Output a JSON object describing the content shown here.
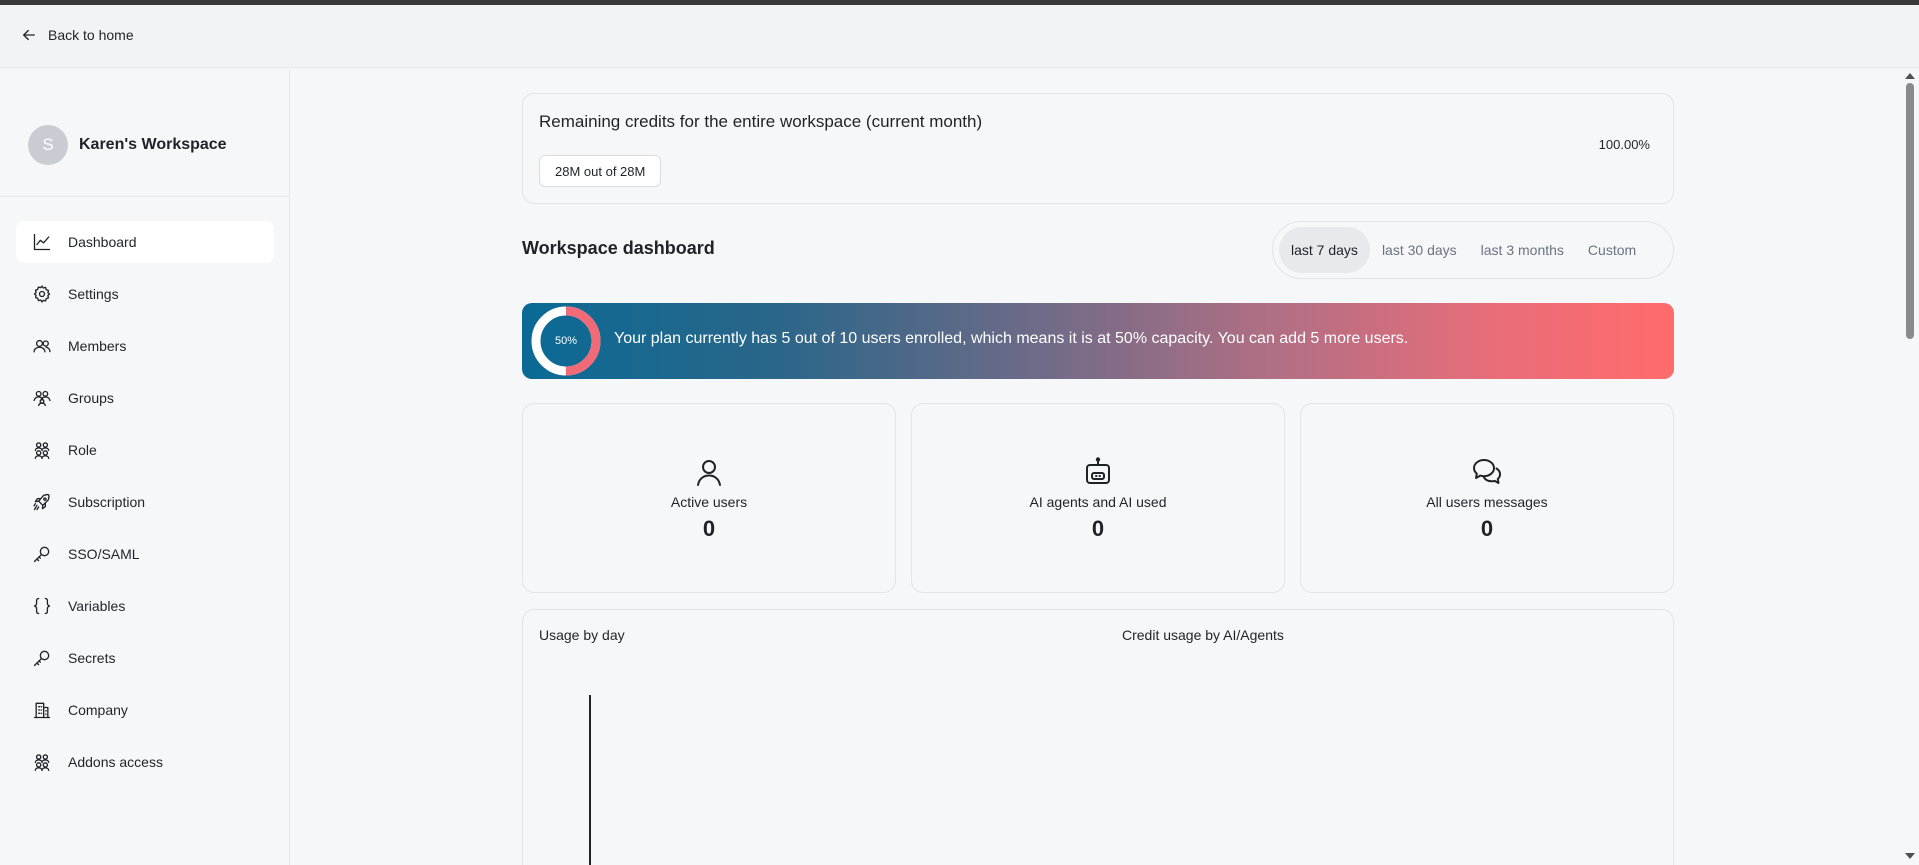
{
  "topbar": {
    "back_label": "Back to home"
  },
  "workspace": {
    "avatar_letter": "S",
    "name": "Karen's Workspace"
  },
  "sidebar": {
    "items": [
      {
        "label": "Dashboard",
        "icon": "chart-line-icon",
        "active": true
      },
      {
        "label": "Settings",
        "icon": "gear-icon"
      },
      {
        "label": "Members",
        "icon": "users-icon"
      },
      {
        "label": "Groups",
        "icon": "groups-icon"
      },
      {
        "label": "Role",
        "icon": "role-icon"
      },
      {
        "label": "Subscription",
        "icon": "rocket-icon"
      },
      {
        "label": "SSO/SAML",
        "icon": "key-icon"
      },
      {
        "label": "Variables",
        "icon": "braces-icon"
      },
      {
        "label": "Secrets",
        "icon": "key-icon"
      },
      {
        "label": "Company",
        "icon": "building-icon"
      },
      {
        "label": "Addons access",
        "icon": "addons-icon"
      }
    ]
  },
  "credits": {
    "title": "Remaining credits for the entire workspace (current month)",
    "percent": "100.00%",
    "badge": "28M out of 28M"
  },
  "dashboard": {
    "title": "Workspace dashboard",
    "ranges": [
      "last 7 days",
      "last 30 days",
      "last 3 months",
      "Custom"
    ],
    "active_range": "last 7 days"
  },
  "banner": {
    "percent_label": "50%",
    "capacity": 0.5,
    "text": "Your plan currently has 5 out of 10 users enrolled, which means it is at 50% capacity. You can add 5 more users.",
    "colors": {
      "start": "#0a6a95",
      "end": "#ff6b6b"
    }
  },
  "stats": [
    {
      "label": "Active users",
      "value": "0",
      "icon": "user-icon"
    },
    {
      "label": "AI agents and AI used",
      "value": "0",
      "icon": "robot-icon"
    },
    {
      "label": "All users messages",
      "value": "0",
      "icon": "chat-bubbles-icon"
    }
  ],
  "usage": {
    "left_title": "Usage by day",
    "right_title": "Credit usage by AI/Agents"
  }
}
